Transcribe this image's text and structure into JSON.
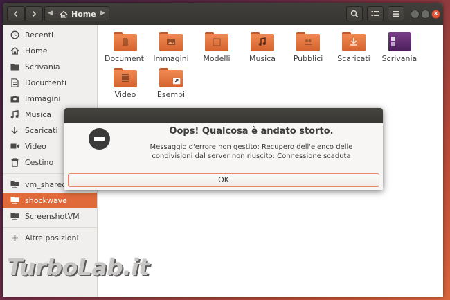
{
  "headerbar": {
    "path_label": "Home"
  },
  "sidebar": {
    "items": [
      {
        "label": "Recenti",
        "icon": "clock-icon"
      },
      {
        "label": "Home",
        "icon": "home-icon"
      },
      {
        "label": "Scrivania",
        "icon": "folder-icon"
      },
      {
        "label": "Documenti",
        "icon": "document-icon"
      },
      {
        "label": "Immagini",
        "icon": "camera-icon"
      },
      {
        "label": "Musica",
        "icon": "music-icon"
      },
      {
        "label": "Scaricati",
        "icon": "download-icon"
      },
      {
        "label": "Video",
        "icon": "video-icon"
      },
      {
        "label": "Cestino",
        "icon": "trash-icon"
      },
      {
        "label": "vm_sharedfo",
        "icon": "network-folder-icon"
      },
      {
        "label": "shockwave",
        "icon": "network-folder-icon",
        "active": true
      },
      {
        "label": "ScreenshotVM",
        "icon": "network-folder-icon"
      },
      {
        "label": "Altre posizioni",
        "icon": "plus-icon"
      }
    ]
  },
  "files": [
    {
      "name": "Documenti",
      "emblem": "document"
    },
    {
      "name": "Immagini",
      "emblem": "image"
    },
    {
      "name": "Modelli",
      "emblem": "template"
    },
    {
      "name": "Musica",
      "emblem": "music"
    },
    {
      "name": "Pubblici",
      "emblem": "share"
    },
    {
      "name": "Scaricati",
      "emblem": "download"
    },
    {
      "name": "Scrivania",
      "emblem": "desktop"
    },
    {
      "name": "Video",
      "emblem": "video"
    },
    {
      "name": "Esempi",
      "emblem": "link"
    }
  ],
  "dialog": {
    "title": "Oops! Qualcosa è andato storto.",
    "message_line1": "Messaggio d'errore non gestito: Recupero dell'elenco delle",
    "message_line2": "condivisioni dal server non riuscito: Connessione scaduta",
    "ok_label": "OK"
  },
  "watermark": {
    "text": "TurboLab.it"
  },
  "colors": {
    "accent": "#e16a3b",
    "headerbar": "#3a3935",
    "folder": "#e0743e",
    "error_icon": "#3a3a3a"
  }
}
